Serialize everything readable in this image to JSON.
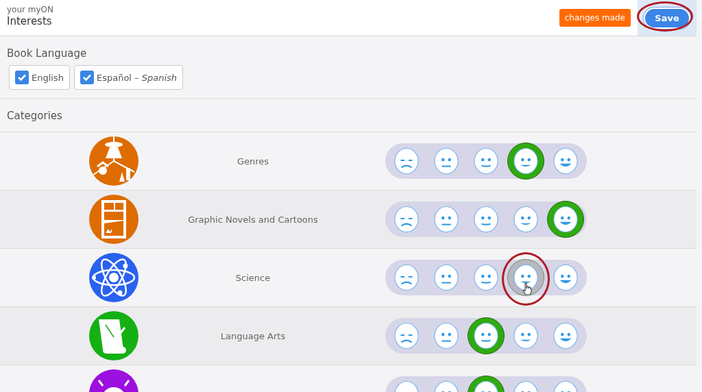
{
  "header": {
    "subtitle": "your myON",
    "title": "Interests",
    "status_badge": "changes made",
    "save_button": {
      "label": "Save",
      "annotated": true
    }
  },
  "book_language": {
    "heading": "Book Language",
    "options": [
      {
        "label": "English",
        "checked": true
      },
      {
        "label": "Español – *Spanish*",
        "checked": true
      }
    ]
  },
  "categories": {
    "heading": "Categories",
    "rows": [
      {
        "kind": "genres",
        "color": "#de6c00",
        "label": "Genres",
        "ratings": [
          {
            "selected": false
          },
          {
            "selected": false
          },
          {
            "selected": false
          },
          {
            "selected": true
          },
          {
            "selected": false
          }
        ]
      },
      {
        "kind": "graphic",
        "color": "#de6c00",
        "label": "Graphic Novels and Cartoons",
        "ratings": [
          {
            "selected": false
          },
          {
            "selected": false
          },
          {
            "selected": false
          },
          {
            "selected": false
          },
          {
            "selected": true
          }
        ]
      },
      {
        "kind": "science",
        "color": "#2962f0",
        "label": "Science",
        "ratings": [
          {
            "selected": false
          },
          {
            "selected": false
          },
          {
            "selected": false
          },
          {
            "selected": false,
            "hovered": true,
            "annotated": true
          },
          {
            "selected": false
          }
        ]
      },
      {
        "kind": "language",
        "color": "#14b014",
        "label": "Language Arts",
        "ratings": [
          {
            "selected": false
          },
          {
            "selected": false
          },
          {
            "selected": true
          },
          {
            "selected": false
          },
          {
            "selected": false
          }
        ]
      },
      {
        "kind": "social",
        "color": "#9c10e0",
        "ratings": [
          {
            "selected": false
          },
          {
            "selected": false
          },
          {
            "selected": true
          },
          {
            "selected": false
          },
          {
            "selected": false
          }
        ]
      }
    ]
  }
}
